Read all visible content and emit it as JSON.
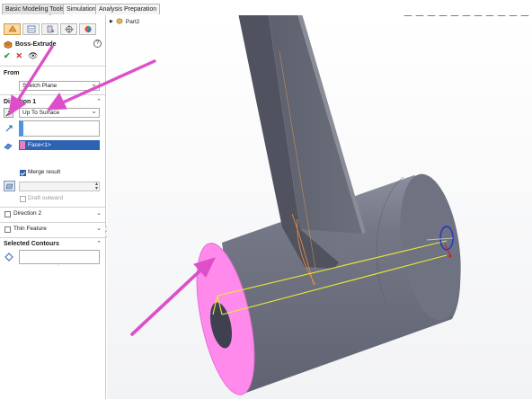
{
  "ribbon": {
    "tabs": [
      {
        "label": "Basic Modeling Tools",
        "active": true
      },
      {
        "label": "Simulation",
        "active": false
      },
      {
        "label": "Analysis Preparation",
        "active": false
      }
    ]
  },
  "property_manager": {
    "title": "Boss-Extrude",
    "help_glyph": "?",
    "icon_tabs": [
      "feature-manager-icon",
      "property-manager-icon",
      "configuration-manager-icon",
      "dimxpert-icon",
      "display-manager-icon"
    ],
    "actions": {
      "ok": "✔",
      "cancel": "✕",
      "preview": "👁"
    },
    "from": {
      "label": "From",
      "value": "Sketch Plane"
    },
    "direction1": {
      "label": "Direction 1",
      "end_condition": "Up To Surface",
      "face_value": "Face<1>",
      "merge_result_label": "Merge result",
      "merge_result_checked": true,
      "draft_outward_label": "Draft outward",
      "draft_outward_checked": false
    },
    "direction2": {
      "label": "Direction 2"
    },
    "thin_feature": {
      "label": "Thin Feature"
    },
    "selected_contours": {
      "label": "Selected Contours"
    }
  },
  "graphics": {
    "tree_root": "Part2",
    "hud_icons": [
      "transform-icon",
      "zoom-to-fit-icon",
      "zoom-area-icon",
      "previous-view-icon",
      "section-view-icon",
      "view-orientation-icon",
      "display-style-icon",
      "hide-show-icon",
      "appearance-icon",
      "scene-icon",
      "view-settings-icon"
    ]
  },
  "colors": {
    "body": "#6e7180",
    "body_light": "#878a98",
    "body_dark": "#4f5260",
    "face_highlight": "#ff8aeb",
    "face_selected_swatch": "#ea7fc9",
    "arrow": "#dd4fc9",
    "selection_blue": "#2e62b3",
    "sketch_yellow": "#e9ea35"
  }
}
